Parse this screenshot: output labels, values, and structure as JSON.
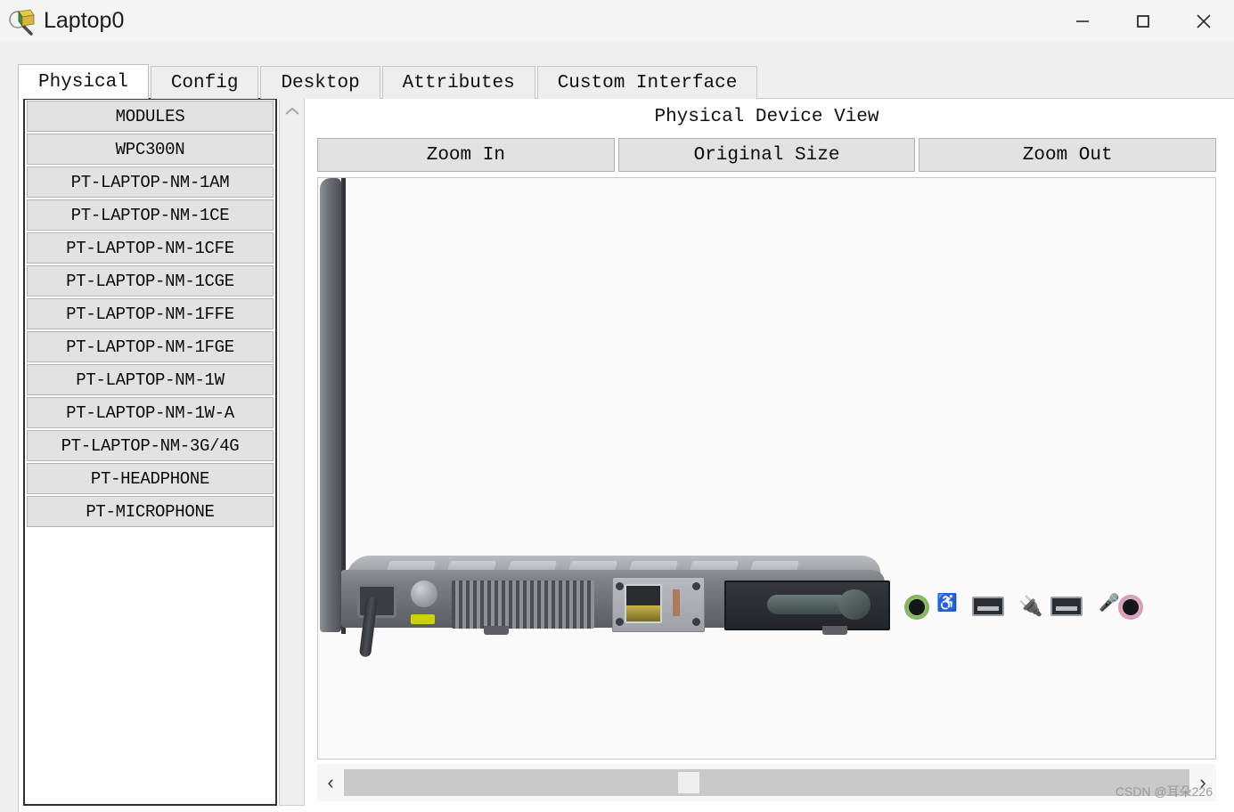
{
  "window": {
    "title": "Laptop0",
    "icon": "inspect-magnifier-icon",
    "controls": {
      "minimize": "—",
      "maximize": "□",
      "close": "✕"
    }
  },
  "tabs": [
    {
      "label": "Physical",
      "active": true
    },
    {
      "label": "Config",
      "active": false
    },
    {
      "label": "Desktop",
      "active": false
    },
    {
      "label": "Attributes",
      "active": false
    },
    {
      "label": "Custom Interface",
      "active": false
    }
  ],
  "modules": {
    "header": "MODULES",
    "items": [
      "WPC300N",
      "PT-LAPTOP-NM-1AM",
      "PT-LAPTOP-NM-1CE",
      "PT-LAPTOP-NM-1CFE",
      "PT-LAPTOP-NM-1CGE",
      "PT-LAPTOP-NM-1FFE",
      "PT-LAPTOP-NM-1FGE",
      "PT-LAPTOP-NM-1W",
      "PT-LAPTOP-NM-1W-A",
      "PT-LAPTOP-NM-3G/4G",
      "PT-HEADPHONE",
      "PT-MICROPHONE"
    ],
    "scroll_up_icon": "chevron-up-icon"
  },
  "device_view": {
    "header": "Physical Device View",
    "buttons": {
      "zoom_in": "Zoom In",
      "original_size": "Original Size",
      "zoom_out": "Zoom Out"
    },
    "scrollbar": {
      "left_arrow": "‹",
      "right_arrow": "›"
    }
  },
  "watermark": "CSDN @耳朵226",
  "colors": {
    "window_bg": "#f0f0f0",
    "panel_bg": "#ffffff",
    "button_face": "#e2e2e2",
    "tab_active": "#ffffff",
    "tab_inactive": "#eeeeee",
    "border": "#2e3033",
    "led_green": "#cbd211",
    "jack_green": "#8fbf6a",
    "jack_pink": "#e2a8c4"
  }
}
